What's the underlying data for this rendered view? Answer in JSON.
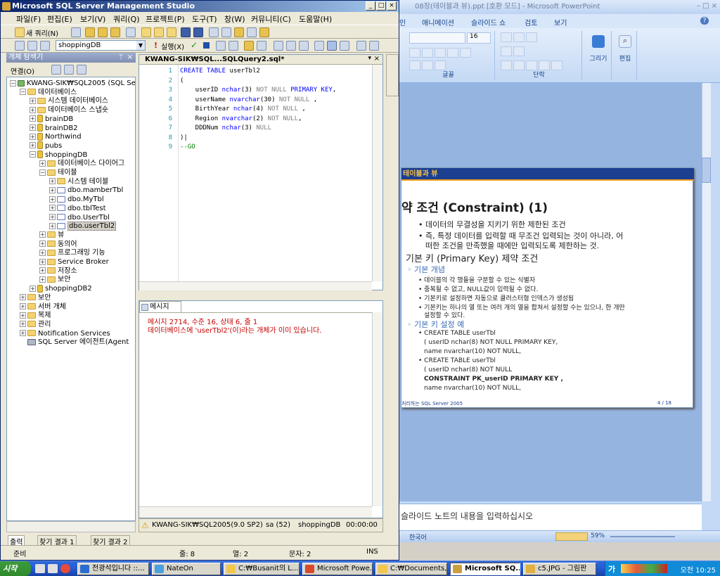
{
  "ssms": {
    "title": "Microsoft SQL Server Management Studio",
    "window_buttons": [
      "_",
      "□",
      "×"
    ],
    "menu": [
      "파일(F)",
      "편집(E)",
      "보기(V)",
      "쿼리(Q)",
      "프로젝트(P)",
      "도구(T)",
      "창(W)",
      "커뮤니티(C)",
      "도움말(H)"
    ],
    "toolbar1": {
      "new_query": "새 쿼리(N)"
    },
    "toolbar2": {
      "database": "shoppingDB",
      "execute": "실행(X)"
    },
    "object_explorer": {
      "header": "개체 탐색기",
      "connect": "연결(O)",
      "tree": [
        {
          "label": "KWANG-SIK₩SQL2005 (SQL Se",
          "level": 0,
          "expander": "−",
          "icon": "server-icon"
        },
        {
          "label": "데이터베이스",
          "level": 1,
          "expander": "−",
          "icon": "folder-icon"
        },
        {
          "label": "시스템 데이터베이스",
          "level": 2,
          "expander": "+",
          "icon": "folder-icon"
        },
        {
          "label": "데이터베이스 스냅숏",
          "level": 2,
          "expander": "+",
          "icon": "folder-icon"
        },
        {
          "label": "brainDB",
          "level": 2,
          "expander": "+",
          "icon": "database-icon"
        },
        {
          "label": "brainDB2",
          "level": 2,
          "expander": "+",
          "icon": "database-icon"
        },
        {
          "label": "Northwind",
          "level": 2,
          "expander": "+",
          "icon": "database-icon"
        },
        {
          "label": "pubs",
          "level": 2,
          "expander": "+",
          "icon": "database-icon"
        },
        {
          "label": "shoppingDB",
          "level": 2,
          "expander": "−",
          "icon": "database-icon"
        },
        {
          "label": "데이터베이스 다이어그",
          "level": 3,
          "expander": "+",
          "icon": "folder-icon"
        },
        {
          "label": "테이블",
          "level": 3,
          "expander": "−",
          "icon": "folder-icon"
        },
        {
          "label": "시스템 테이블",
          "level": 4,
          "expander": "+",
          "icon": "folder-icon"
        },
        {
          "label": "dbo.mamberTbl",
          "level": 4,
          "expander": "+",
          "icon": "table-icon"
        },
        {
          "label": "dbo.MyTbl",
          "level": 4,
          "expander": "+",
          "icon": "table-icon"
        },
        {
          "label": "dbo.tblTest",
          "level": 4,
          "expander": "+",
          "icon": "table-icon"
        },
        {
          "label": "dbo.UserTbl",
          "level": 4,
          "expander": "+",
          "icon": "table-icon"
        },
        {
          "label": "dbo.userTbl2",
          "level": 4,
          "expander": "+",
          "icon": "table-icon",
          "selected": true
        },
        {
          "label": "뷰",
          "level": 3,
          "expander": "+",
          "icon": "folder-icon"
        },
        {
          "label": "동의어",
          "level": 3,
          "expander": "+",
          "icon": "folder-icon"
        },
        {
          "label": "프로그래밍 기능",
          "level": 3,
          "expander": "+",
          "icon": "folder-icon"
        },
        {
          "label": "Service Broker",
          "level": 3,
          "expander": "+",
          "icon": "folder-icon"
        },
        {
          "label": "저장소",
          "level": 3,
          "expander": "+",
          "icon": "folder-icon"
        },
        {
          "label": "보안",
          "level": 3,
          "expander": "+",
          "icon": "folder-icon"
        },
        {
          "label": "shoppingDB2",
          "level": 2,
          "expander": "+",
          "icon": "database-icon"
        },
        {
          "label": "보안",
          "level": 1,
          "expander": "+",
          "icon": "folder-icon"
        },
        {
          "label": "서버 개체",
          "level": 1,
          "expander": "+",
          "icon": "folder-icon"
        },
        {
          "label": "복제",
          "level": 1,
          "expander": "+",
          "icon": "folder-icon"
        },
        {
          "label": "관리",
          "level": 1,
          "expander": "+",
          "icon": "folder-icon"
        },
        {
          "label": "Notification Services",
          "level": 1,
          "expander": "+",
          "icon": "folder-icon"
        },
        {
          "label": "SQL Server 에이전트(Agent",
          "level": 1,
          "expander": "",
          "icon": "agent-icon"
        }
      ],
      "bottom_tabs": [
        "출력",
        "찾기 결과 1",
        "찾기 결과 2"
      ]
    },
    "editor": {
      "tab_title": "KWANG-SIK₩SQL...SQLQuery2.sql*",
      "lines": [
        {
          "num": "1",
          "text": "CREATE TABLE userTbl2"
        },
        {
          "num": "2",
          "text": "("
        },
        {
          "num": "3",
          "text": "    userID nchar(3) NOT NULL PRIMARY KEY,"
        },
        {
          "num": "4",
          "text": "    userName nvarchar(30) NOT NULL ,"
        },
        {
          "num": "5",
          "text": "    BirthYear nchar(4) NOT NULL ,"
        },
        {
          "num": "6",
          "text": "    Region nvarchar(2) NOT NULL,"
        },
        {
          "num": "7",
          "text": "    DDDNum nchar(3) NULL"
        },
        {
          "num": "8",
          "text": ")|"
        },
        {
          "num": "9",
          "text": "--GO"
        }
      ]
    },
    "messages": {
      "tab": "메시지",
      "lines": [
        "메시지 2714, 수준 16, 상태 6, 줄 1",
        "데이터베이스에 'userTbl2'(이)라는 개체가 이미 있습니다."
      ]
    },
    "query_status": {
      "server": "KWANG-SIK₩SQL2005(9.0 SP2)",
      "user": "sa (52)",
      "db": "shoppingDB",
      "time": "00:00:00"
    },
    "status": {
      "ready": "준비",
      "line": "줄: 8",
      "col": "열: 2",
      "char": "문자: 2",
      "mode": "INS"
    }
  },
  "ppt": {
    "title": "08장(테이블과 뷰).ppt [호환 모드] - Microsoft PowerPoint",
    "tabs": [
      "인",
      "애니메이션",
      "슬라이드 쇼",
      "검토",
      "보기"
    ],
    "ribbon": {
      "font_size": "16",
      "groups": [
        "글꼴",
        "단락"
      ],
      "draw": "그리기",
      "edit": "편집"
    },
    "slide": {
      "header": "테이블과 뷰",
      "title": "약 조건 (Constraint)   (1)",
      "bullets": [
        "데이터의 무결성을 지키기 위한 제한된 조건",
        "즉, 특정 데이터를 입력할 때 무조건 입력되는 것이 아니라, 어",
        "떠한 조건을 만족했을 때에만 입력되도록 제한하는 것."
      ],
      "h2": "기본 키 (Primary Key) 제약 조건",
      "sub1": "기본 개념",
      "sub1_items": [
        "데이블의 각 행들을 구분할 수 있는 식별자",
        "중복될 수 없고, NULL값이 입력될 수 없다.",
        "기본키로 설정하면 자동으로 클러스터형 인덱스가 생성됨",
        "기본키는 하나의 열 또는 여러 개의 열을 합쳐서 설정할 수는 있으나, 한 개만",
        "설정할 수 있다."
      ],
      "sub2": "기본 키 설정 예",
      "sub2_items": [
        "CREATE TABLE userTbl",
        "( userID  nchar(8) NOT NULL PRIMARY KEY,",
        "  name    nvarchar(10) NOT NULL,",
        "CREATE TABLE userTbl",
        "( userID  nchar(8) NOT NULL",
        "             CONSTRAINT PK_userID PRIMARY KEY ,",
        "  name    nvarchar(10) NOT NULL,"
      ],
      "footer_left": "처리하는 SQL Server 2005",
      "footer_right": "4 / 18"
    },
    "notes_placeholder": "슬라이드 노트의 내용을 입력하십시오",
    "status": {
      "lang": "한국어",
      "zoom": "59%"
    }
  },
  "taskbar": {
    "start": "시작",
    "buttons": [
      {
        "label": "전광석입니다 ::...",
        "active": false
      },
      {
        "label": "NateOn",
        "active": false
      },
      {
        "label": "C:₩Busanit의 L...",
        "active": false
      },
      {
        "label": "Microsoft Powe...",
        "active": false
      },
      {
        "label": "C:₩Documents,...",
        "active": false
      },
      {
        "label": "Microsoft SQ...",
        "active": true
      },
      {
        "label": "c5.JPG - 그림판",
        "active": false
      }
    ],
    "ime": "가",
    "clock": "오전 10:25"
  }
}
